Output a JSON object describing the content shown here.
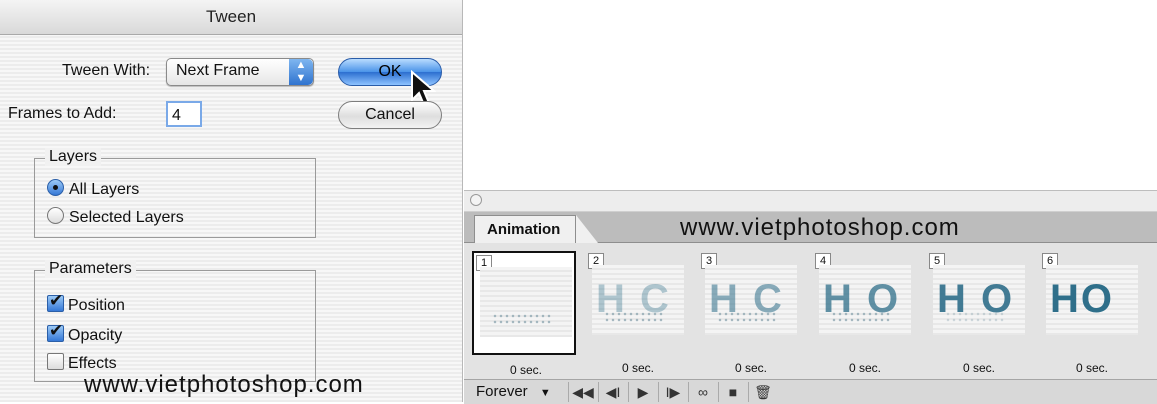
{
  "dialog": {
    "title": "Tween",
    "tween_with_label": "Tween With:",
    "tween_with_value": "Next Frame",
    "frames_label": "Frames to Add:",
    "frames_value": "4",
    "ok_label": "OK",
    "cancel_label": "Cancel",
    "layers": {
      "title": "Layers",
      "options": [
        "All Layers",
        "Selected Layers"
      ],
      "selected": "All Layers"
    },
    "parameters": {
      "title": "Parameters",
      "items": [
        {
          "label": "Position",
          "checked": true
        },
        {
          "label": "Opacity",
          "checked": true
        },
        {
          "label": "Effects",
          "checked": false
        }
      ]
    }
  },
  "watermarks": [
    "www.vietphotoshop.com",
    "www.vietphotoshop.com"
  ],
  "animation": {
    "tab_label": "Animation",
    "frames": [
      {
        "number": "1",
        "content": "",
        "delay": "0 sec.",
        "selected": true
      },
      {
        "number": "2",
        "content": "H  C",
        "delay": "0 sec.",
        "selected": false
      },
      {
        "number": "3",
        "content": "H C",
        "delay": "0 sec.",
        "selected": false
      },
      {
        "number": "4",
        "content": "H O",
        "delay": "0 sec.",
        "selected": false
      },
      {
        "number": "5",
        "content": "H O",
        "delay": "0 sec.",
        "selected": false
      },
      {
        "number": "6",
        "content": "HO",
        "delay": "0 sec.",
        "selected": false
      }
    ],
    "loop_value": "Forever",
    "icons": [
      "first-frame-icon",
      "previous-frame-icon",
      "play-icon",
      "next-frame-icon",
      "tween-icon",
      "new-frame-icon",
      "trash-icon"
    ]
  }
}
